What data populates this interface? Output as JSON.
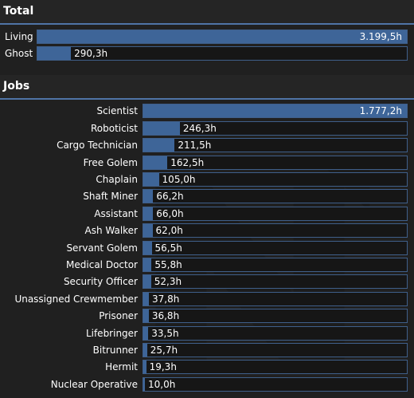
{
  "total": {
    "title": "Total",
    "rows": [
      {
        "label": "Living",
        "value_text": "3.199,5h",
        "value": 3199.5
      },
      {
        "label": "Ghost",
        "value_text": "290,3h",
        "value": 290.3
      }
    ]
  },
  "jobs": {
    "title": "Jobs",
    "rows": [
      {
        "label": "Scientist",
        "value_text": "1.777,2h",
        "value": 1777.2
      },
      {
        "label": "Roboticist",
        "value_text": "246,3h",
        "value": 246.3
      },
      {
        "label": "Cargo Technician",
        "value_text": "211,5h",
        "value": 211.5
      },
      {
        "label": "Free Golem",
        "value_text": "162,5h",
        "value": 162.5
      },
      {
        "label": "Chaplain",
        "value_text": "105,0h",
        "value": 105.0
      },
      {
        "label": "Shaft Miner",
        "value_text": "66,2h",
        "value": 66.2
      },
      {
        "label": "Assistant",
        "value_text": "66,0h",
        "value": 66.0
      },
      {
        "label": "Ash Walker",
        "value_text": "62,0h",
        "value": 62.0
      },
      {
        "label": "Servant Golem",
        "value_text": "56,5h",
        "value": 56.5
      },
      {
        "label": "Medical Doctor",
        "value_text": "55,8h",
        "value": 55.8
      },
      {
        "label": "Security Officer",
        "value_text": "52,3h",
        "value": 52.3
      },
      {
        "label": "Unassigned Crewmember",
        "value_text": "37,8h",
        "value": 37.8
      },
      {
        "label": "Prisoner",
        "value_text": "36,8h",
        "value": 36.8
      },
      {
        "label": "Lifebringer",
        "value_text": "33,5h",
        "value": 33.5
      },
      {
        "label": "Bitrunner",
        "value_text": "25,7h",
        "value": 25.7
      },
      {
        "label": "Hermit",
        "value_text": "19,3h",
        "value": 19.3
      },
      {
        "label": "Nuclear Operative",
        "value_text": "10,0h",
        "value": 10.0
      }
    ]
  },
  "colors": {
    "accent": "#4f74a6",
    "bar_fill": "#3e6598",
    "background": "#202020"
  },
  "icons": {
    "watermark": "nanotrasen-logo-icon"
  }
}
